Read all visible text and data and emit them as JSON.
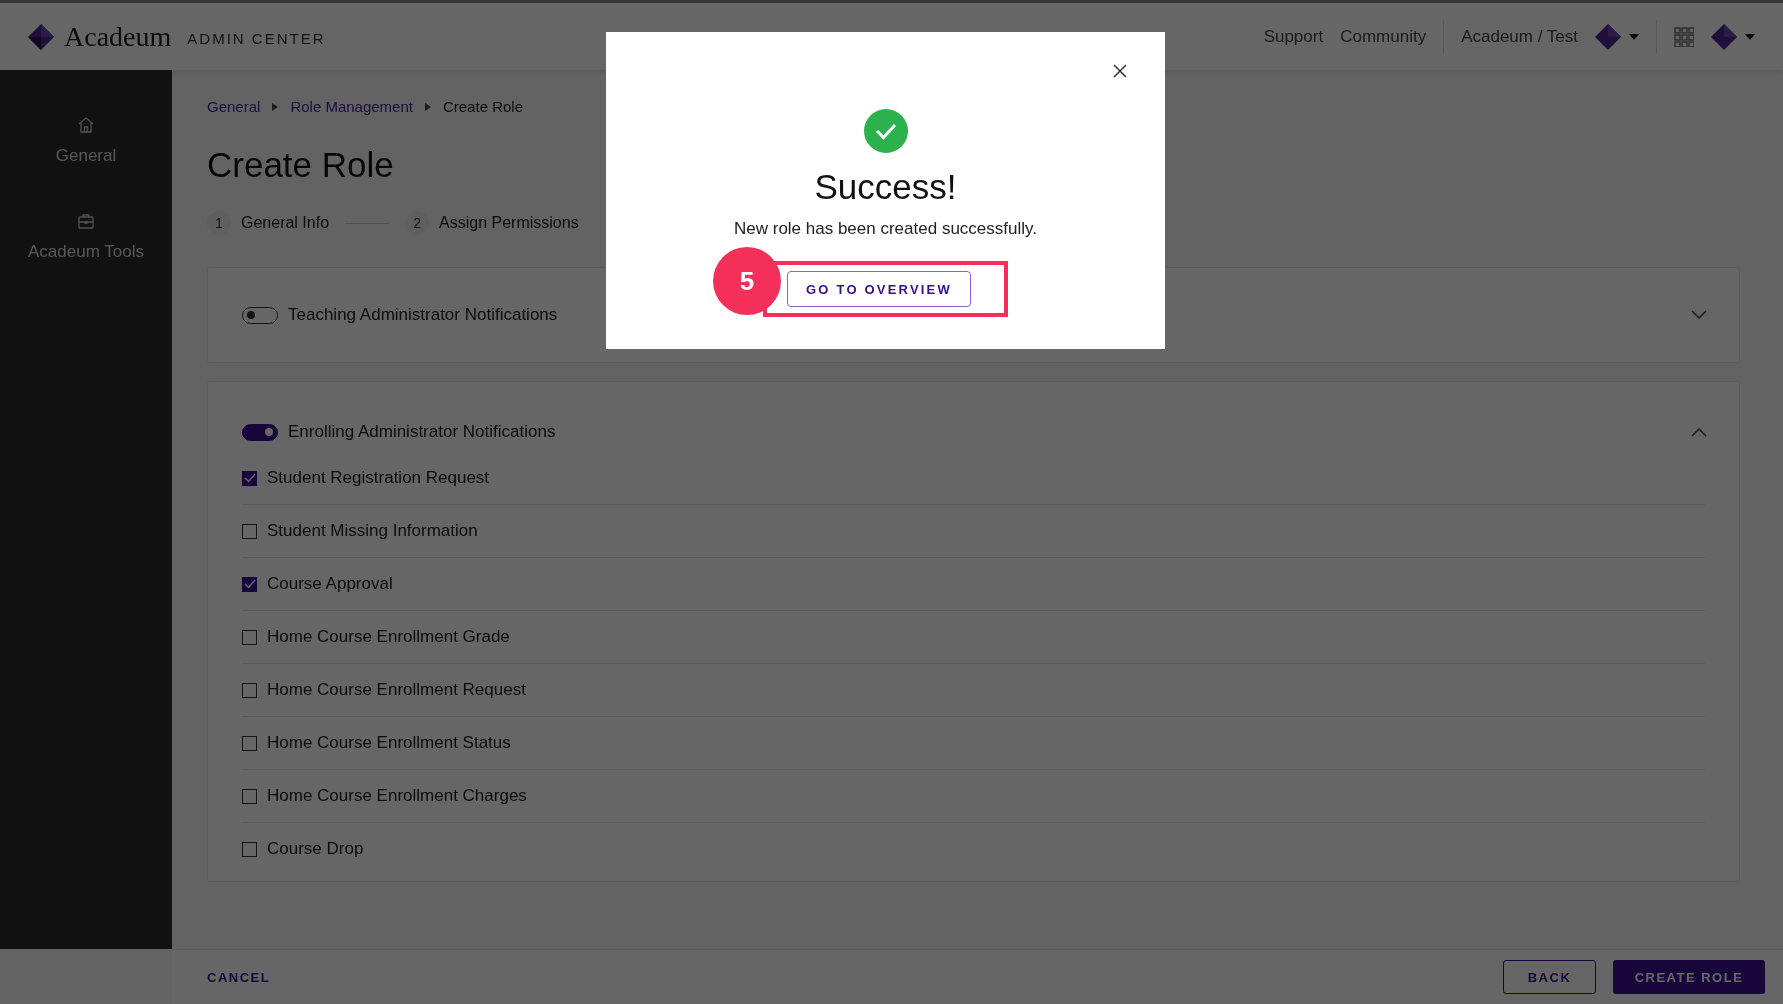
{
  "header": {
    "brand": "Acadeum",
    "subtitle": "ADMIN CENTER",
    "links": [
      "Support",
      "Community"
    ],
    "organization": "Acadeum / Test"
  },
  "sidebar": {
    "items": [
      {
        "label": "General"
      },
      {
        "label": "Acadeum Tools"
      }
    ]
  },
  "breadcrumb": [
    {
      "label": "General",
      "current": false
    },
    {
      "label": "Role Management",
      "current": false
    },
    {
      "label": "Create Role",
      "current": true
    }
  ],
  "title": "Create Role",
  "steps": [
    {
      "number": "1",
      "label": "General Info"
    },
    {
      "number": "2",
      "label": "Assign Permissions"
    }
  ],
  "sections": [
    {
      "label": "Teaching Administrator Notifications",
      "on": false,
      "expanded": false
    },
    {
      "label": "Enrolling Administrator Notifications",
      "on": true,
      "expanded": true,
      "items": [
        {
          "label": "Student Registration Request",
          "checked": true
        },
        {
          "label": "Student Missing Information",
          "checked": false
        },
        {
          "label": "Course Approval",
          "checked": true
        },
        {
          "label": "Home Course Enrollment Grade",
          "checked": false
        },
        {
          "label": "Home Course Enrollment Request",
          "checked": false
        },
        {
          "label": "Home Course Enrollment Status",
          "checked": false
        },
        {
          "label": "Home Course Enrollment Charges",
          "checked": false
        },
        {
          "label": "Course Drop",
          "checked": false
        }
      ]
    }
  ],
  "footer": {
    "cancel": "CANCEL",
    "back": "BACK",
    "create": "CREATE ROLE"
  },
  "modal": {
    "title": "Success!",
    "message": "New role has been created successfully.",
    "button": "GO TO OVERVIEW",
    "step_marker": "5"
  }
}
